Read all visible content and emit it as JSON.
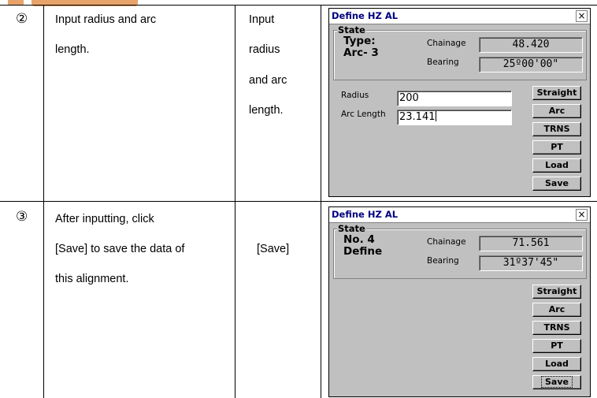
{
  "steps": [
    {
      "number": "②",
      "description": [
        "Input radius and arc",
        "length."
      ],
      "key": [
        "Input",
        "radius",
        "and arc",
        "length."
      ],
      "dialog": {
        "title": "Define HZ AL",
        "close": "×",
        "state_legend": "State",
        "state_line1": "Type:",
        "state_line2": "Arc- 3",
        "chainage_label": "Chainage",
        "chainage_value": "48.420",
        "bearing_label": "Bearing",
        "bearing_value": "25º00'00\"",
        "radius_label": "Radius",
        "radius_value": "200",
        "arc_length_label": "Arc Length",
        "arc_length_value": "23.141",
        "buttons": [
          "Straight",
          "Arc",
          "TRNS",
          "PT",
          "Load",
          "Save"
        ]
      }
    },
    {
      "number": "③",
      "description": [
        "After inputting, click",
        "[Save] to save the data of",
        "this alignment."
      ],
      "key": [
        "[Save]"
      ],
      "dialog": {
        "title": "Define HZ AL",
        "close": "×",
        "state_legend": "State",
        "state_line1": "No. 4",
        "state_line2": "Define",
        "chainage_label": "Chainage",
        "chainage_value": "71.561",
        "bearing_label": "Bearing",
        "bearing_value": "31º37'45\"",
        "buttons": [
          "Straight",
          "Arc",
          "TRNS",
          "PT",
          "Load",
          "Save"
        ]
      }
    }
  ]
}
